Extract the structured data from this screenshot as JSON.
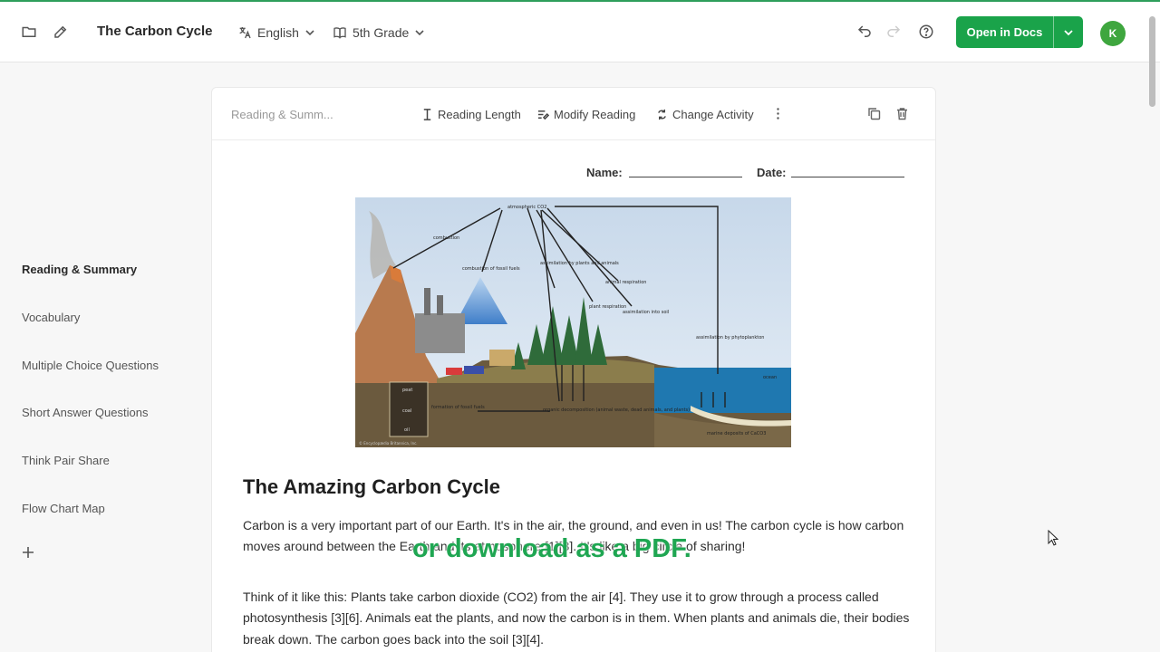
{
  "app": {
    "doc_title": "The Carbon Cycle",
    "language": "English",
    "grade": "5th Grade",
    "open_button": "Open in Docs",
    "avatar_initial": "K",
    "accent": "#1aa34a"
  },
  "icons": [
    "folder-icon",
    "edit-icon",
    "translate-icon",
    "book-icon",
    "undo-icon",
    "redo-icon",
    "help-icon",
    "chevron-down-icon",
    "plus-icon",
    "copy-icon",
    "trash-icon",
    "more-icon",
    "cursor-icon"
  ],
  "sidebar": {
    "items": [
      {
        "label": "Reading & Summary",
        "active": true
      },
      {
        "label": "Vocabulary"
      },
      {
        "label": "Multiple Choice Questions"
      },
      {
        "label": "Short Answer Questions"
      },
      {
        "label": "Think Pair Share"
      },
      {
        "label": "Flow Chart Map"
      }
    ]
  },
  "toolbar": {
    "section_label": "Reading & Summ...",
    "reading_length": "Reading Length",
    "modify_reading": "Modify Reading",
    "change_activity": "Change Activity"
  },
  "worksheet": {
    "name_label": "Name:",
    "date_label": "Date:",
    "heading": "The Amazing Carbon Cycle",
    "paragraphs": [
      "Carbon is a very important part of our Earth. It's in the air, the ground, and even in us! The carbon cycle is how carbon moves around between the Earth and its atmosphere [1][3]. It's like a big circle of sharing!",
      "Think of it like this: Plants take carbon dioxide (CO2) from the air [4]. They use it to grow through a process called photosynthesis [3][6]. Animals eat the plants, and now the carbon is in them. When plants and animals die, their bodies break down. The carbon goes back into the soil [3][4]."
    ]
  },
  "diagram_labels": {
    "co2": "atmospheric CO2",
    "combustion": "combustion",
    "fossil": "combustion of fossil fuels",
    "assim_plants": "assimilation by plants and animals",
    "plant_resp": "plant respiration",
    "animal_resp": "animal respiration",
    "assim_soil": "assimilation into soil",
    "phyto": "assimilation by phytoplankton",
    "ocean": "ocean",
    "formation": "formation of fossil fuels",
    "decomp": "organic decomposition (animal waste, dead animals, and plants)",
    "marine": "marine deposits of CaCO3",
    "peat": "peat",
    "coal": "coal",
    "oil": "oil",
    "credit": "© Encyclopædia Britannica, Inc."
  },
  "overlay": {
    "caption": "or download as a PDF."
  }
}
